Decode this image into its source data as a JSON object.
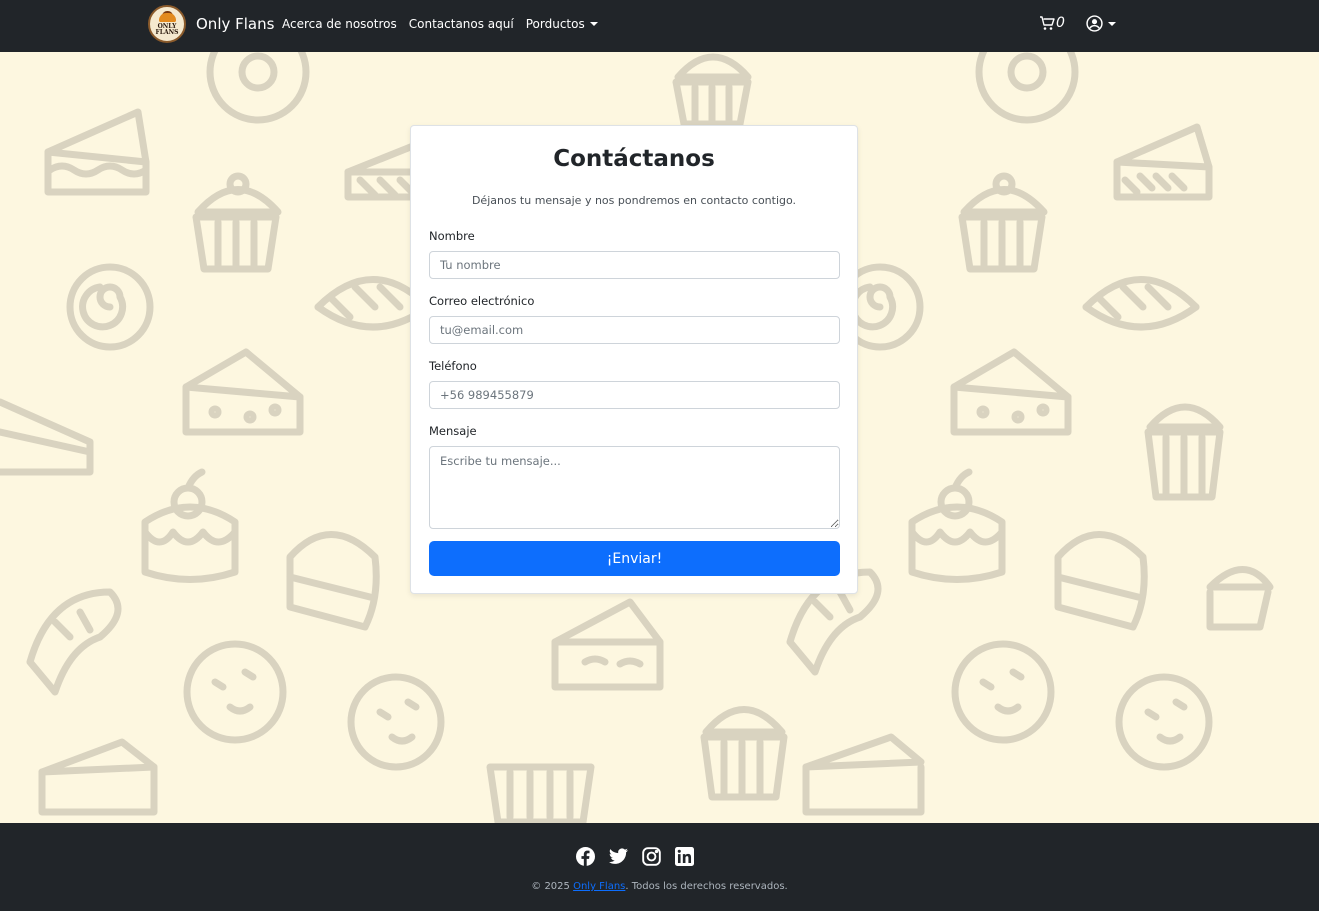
{
  "nav": {
    "logo_text": "ONLY FLANS",
    "brand": "Only Flans",
    "links": [
      "Acerca de nosotros",
      "Contactanos aquí",
      "Porductos"
    ],
    "cart_count": "0"
  },
  "form": {
    "title": "Contáctanos",
    "subtitle": "Déjanos tu mensaje y nos pondremos en contacto contigo.",
    "fields": [
      {
        "label": "Nombre",
        "placeholder": "Tu nombre"
      },
      {
        "label": "Correo electrónico",
        "placeholder": "tu@email.com"
      },
      {
        "label": "Teléfono",
        "placeholder": "+56 989455879"
      },
      {
        "label": "Mensaje",
        "placeholder": "Escribe tu mensaje..."
      }
    ],
    "submit": "¡Enviar!"
  },
  "footer": {
    "socials": [
      "facebook-icon",
      "twitter-icon",
      "instagram-icon",
      "linkedin-icon"
    ],
    "copyright_prefix": "© 2025 ",
    "brand_link": "Only Flans",
    "copyright_suffix": ". Todos los derechos reservados."
  },
  "colors": {
    "navbar": "#212529",
    "background": "#fdf7e0",
    "pattern": "#d9d3c0",
    "primary": "#0d6efd"
  }
}
